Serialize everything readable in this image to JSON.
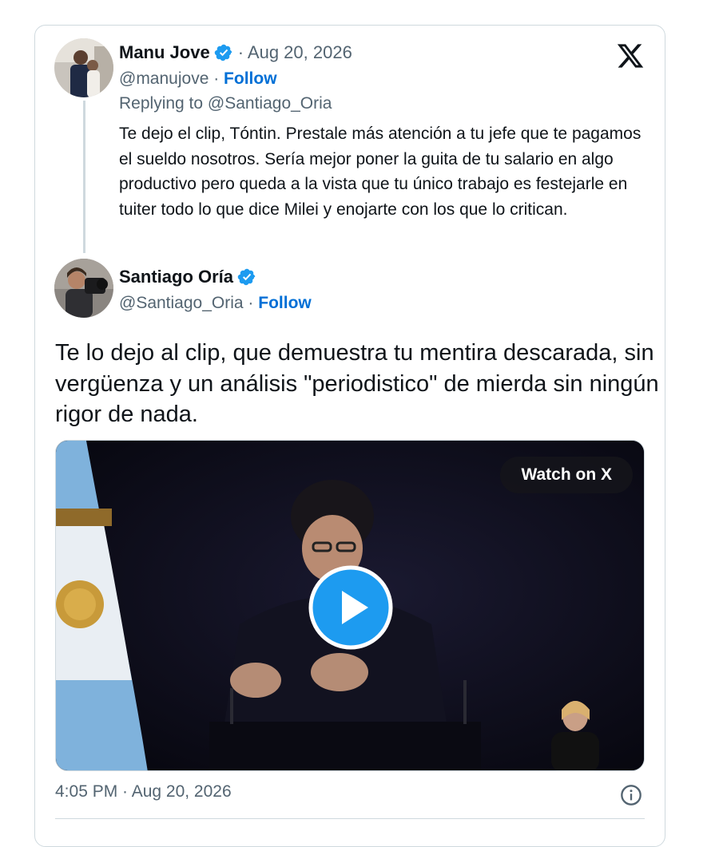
{
  "reply_tweet": {
    "author_name": "Manu Jove",
    "separator_date": "· Aug 20, 2026",
    "handle": "@manujove ·",
    "follow_label": "Follow",
    "replying_to": "Replying to @Santiago_Oria",
    "text": "Te dejo el clip, Tóntin. Prestale más atención a tu jefe que te pagamos el sueldo nosotros. Sería mejor poner la guita de tu salario en algo productivo pero queda a la vista que tu único trabajo es festejarle en tuiter todo lo que dice Milei y enojarte con los que lo critican."
  },
  "main_tweet": {
    "author_name": "Santiago Oría",
    "handle": "@Santiago_Oria ·",
    "follow_label": "Follow",
    "text": "Te lo dejo al clip, que demuestra tu mentira descarada, sin vergüenza y un análisis \"periodistico\" de mierda sin ningún rigor de nada.",
    "media": {
      "watch_label": "Watch on X"
    },
    "timestamp": "4:05 PM · Aug 20, 2026"
  },
  "icons": {
    "verified": "verified-badge-icon",
    "brand": "x-logo-icon",
    "play": "play-icon",
    "info": "info-icon"
  },
  "colors": {
    "follow": "#006fd6",
    "verified": "#1d9bf0",
    "muted_text": "#536471",
    "border": "#cfd9de"
  }
}
